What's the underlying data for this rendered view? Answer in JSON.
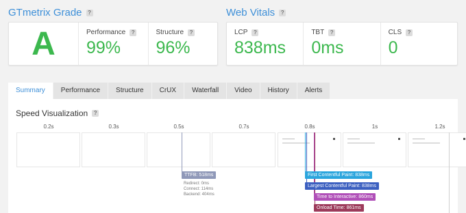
{
  "grade_section": {
    "title": "GTmetrix Grade",
    "help": "?"
  },
  "grade": {
    "letter": "A"
  },
  "grade_metrics": [
    {
      "label": "Performance",
      "value": "99%"
    },
    {
      "label": "Structure",
      "value": "96%"
    }
  ],
  "vitals_section": {
    "title": "Web Vitals",
    "help": "?"
  },
  "vitals": [
    {
      "label": "LCP",
      "value": "838ms"
    },
    {
      "label": "TBT",
      "value": "0ms"
    },
    {
      "label": "CLS",
      "value": "0"
    }
  ],
  "tabs": [
    "Summary",
    "Performance",
    "Structure",
    "CrUX",
    "Waterfall",
    "Video",
    "History",
    "Alerts"
  ],
  "speed_viz": {
    "title": "Speed Visualization",
    "help": "?",
    "ticks": [
      "0.2s",
      "0.3s",
      "0.5s",
      "0.7s",
      "0.8s",
      "1s",
      "1.2s"
    ],
    "ttfb": {
      "label": "TTFB: 518ms",
      "details": [
        "Redirect: 0ms",
        "Connect: 114ms",
        "Backend: 404ms"
      ]
    },
    "markers": [
      {
        "label": "First Contentful Paint: 838ms"
      },
      {
        "label": "Largest Contentful Paint: 838ms"
      },
      {
        "label": "Time to Interactive: 860ms"
      },
      {
        "label": "Onload Time: 861ms"
      }
    ]
  },
  "colors": {
    "accent": "#3d8fd8",
    "grade_green": "#3cb84e",
    "ttfb": "#8f98b8",
    "fcp": "#2aa5dd",
    "lcp": "#3b5fc0",
    "tti": "#b04fb8",
    "onload": "#9c3a5a"
  }
}
